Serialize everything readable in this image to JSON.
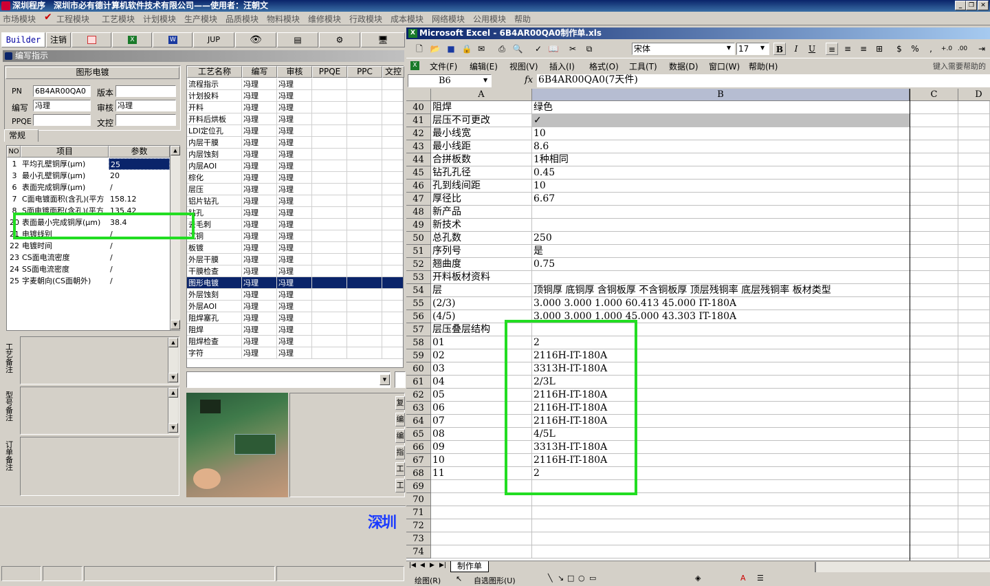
{
  "app_title": "深圳程序　深圳市必有德计算机软件技术有限公司——使用者：汪朝文",
  "menu": [
    "市场模块",
    "工程模块",
    "工艺模块",
    "计划模块",
    "生产模块",
    "品质模块",
    "物料模块",
    "维修模块",
    "行政模块",
    "成本模块",
    "网络模块",
    "公用模块",
    "帮助"
  ],
  "toolbar": {
    "builder": "Builder",
    "logout": "注销",
    "jup": "JUP"
  },
  "panel_title": "编写指示",
  "form": {
    "section_title": "图形电镀",
    "pn_label": "PN",
    "pn_value": "6B4AR00QA0",
    "version_label": "版本",
    "version_value": "",
    "writer_label": "编写",
    "writer_value": "冯理",
    "reviewer_label": "审核",
    "reviewer_value": "冯理",
    "ppqe_label": "PPQE",
    "ppqe_value": "",
    "control_label": "文控",
    "control_value": ""
  },
  "tab_general": "常规",
  "param_table": {
    "headers": [
      "NO",
      "项目",
      "参数"
    ],
    "rows": [
      {
        "no": "1",
        "item": "平均孔壁铜厚(μm)",
        "value": "25"
      },
      {
        "no": "3",
        "item": "最小孔壁铜厚(μm)",
        "value": "20"
      },
      {
        "no": "6",
        "item": "表面完成铜厚(μm)",
        "value": "/"
      },
      {
        "no": "7",
        "item": "C面电镀面积(含孔)(平方",
        "value": "158.12"
      },
      {
        "no": "8",
        "item": "S面电镀面积(含孔)(平方",
        "value": "135.42"
      },
      {
        "no": "20",
        "item": "表面最小完成铜厚(μm)",
        "value": "38.4"
      },
      {
        "no": "21",
        "item": "电镀线别",
        "value": "/"
      },
      {
        "no": "22",
        "item": "电镀时间",
        "value": "/"
      },
      {
        "no": "23",
        "item": "CS面电流密度",
        "value": "/"
      },
      {
        "no": "24",
        "item": "SS面电流密度",
        "value": "/"
      },
      {
        "no": "25",
        "item": "字麦朝向(CS面朝外)",
        "value": "/"
      }
    ]
  },
  "notes": {
    "process": "工艺备注",
    "model": "型号备注",
    "order": "订单备注"
  },
  "process_table": {
    "headers": [
      "工艺名称",
      "编写",
      "审核",
      "PPQE",
      "PPC",
      "文控"
    ],
    "rows": [
      {
        "name": "流程指示",
        "w": "冯理",
        "r": "冯理"
      },
      {
        "name": "计划投料",
        "w": "冯理",
        "r": "冯理"
      },
      {
        "name": "开料",
        "w": "冯理",
        "r": "冯理"
      },
      {
        "name": "开料后烘板",
        "w": "冯理",
        "r": "冯理"
      },
      {
        "name": "LDI定位孔",
        "w": "冯理",
        "r": "冯理"
      },
      {
        "name": "内层干膜",
        "w": "冯理",
        "r": "冯理"
      },
      {
        "name": "内层蚀刻",
        "w": "冯理",
        "r": "冯理"
      },
      {
        "name": "内层AOI",
        "w": "冯理",
        "r": "冯理"
      },
      {
        "name": "棕化",
        "w": "冯理",
        "r": "冯理"
      },
      {
        "name": "层压",
        "w": "冯理",
        "r": "冯理"
      },
      {
        "name": "铝片钻孔",
        "w": "冯理",
        "r": "冯理"
      },
      {
        "name": "钻孔",
        "w": "冯理",
        "r": "冯理"
      },
      {
        "name": "去毛刺",
        "w": "冯理",
        "r": "冯理"
      },
      {
        "name": "沉铜",
        "w": "冯理",
        "r": "冯理"
      },
      {
        "name": "板镀",
        "w": "冯理",
        "r": "冯理"
      },
      {
        "name": "外层干膜",
        "w": "冯理",
        "r": "冯理"
      },
      {
        "name": "干膜检查",
        "w": "冯理",
        "r": "冯理"
      },
      {
        "name": "图形电镀",
        "w": "冯理",
        "r": "冯理"
      },
      {
        "name": "外层蚀刻",
        "w": "冯理",
        "r": "冯理"
      },
      {
        "name": "外层AOI",
        "w": "冯理",
        "r": "冯理"
      },
      {
        "name": "阻焊塞孔",
        "w": "冯理",
        "r": "冯理"
      },
      {
        "name": "阻焊",
        "w": "冯理",
        "r": "冯理"
      },
      {
        "name": "阻焊检查",
        "w": "冯理",
        "r": "冯理"
      },
      {
        "name": "字符",
        "w": "冯理",
        "r": "冯理"
      }
    ]
  },
  "side_buttons": [
    "复",
    "编",
    "编",
    "指",
    "工",
    "工"
  ],
  "excel": {
    "title": "Microsoft Excel - 6B4AR00QA0制作单.xls",
    "menu": [
      "文件(F)",
      "编辑(E)",
      "视图(V)",
      "插入(I)",
      "格式(O)",
      "工具(T)",
      "数据(D)",
      "窗口(W)",
      "帮助(H)"
    ],
    "help_placeholder": "键入需要帮助的",
    "font_name": "宋体",
    "font_size": "17",
    "name_box": "B6",
    "formula": "6B4AR00QA0(7天件)",
    "columns": [
      "A",
      "B",
      "C",
      "D"
    ],
    "sheet_tab": "制作单",
    "rows": [
      {
        "n": "40",
        "a": "阻焊",
        "b": "绿色"
      },
      {
        "n": "41",
        "a": "层压不可更改",
        "b": "✓"
      },
      {
        "n": "42",
        "a": "最小线宽",
        "b": "10"
      },
      {
        "n": "43",
        "a": "最小线距",
        "b": "8.6"
      },
      {
        "n": "44",
        "a": "合拼板数",
        "b": "1种相同"
      },
      {
        "n": "45",
        "a": "钻孔孔径",
        "b": "0.45"
      },
      {
        "n": "46",
        "a": "孔到线间距",
        "b": "10"
      },
      {
        "n": "47",
        "a": "厚径比",
        "b": "6.67"
      },
      {
        "n": "48",
        "a": "新产品",
        "b": ""
      },
      {
        "n": "49",
        "a": "新技术",
        "b": ""
      },
      {
        "n": "50",
        "a": "总孔数",
        "b": "250"
      },
      {
        "n": "51",
        "a": "序列号",
        "b": "是"
      },
      {
        "n": "52",
        "a": "翘曲度",
        "b": "0.75"
      },
      {
        "n": "53",
        "a": "开料板材资料",
        "b": ""
      },
      {
        "n": "54",
        "a": "层",
        "b": "顶铜厚 底铜厚 含铜板厚 不含铜板厚 顶层残铜率 底层残铜率 板材类型"
      },
      {
        "n": "55",
        "a": "(2/3)",
        "b": "3.000  3.000  1.000           60.413  45.000   IT-180A"
      },
      {
        "n": "56",
        "a": "(4/5)",
        "b": "3.000  3.000  1.000           45.000  43.303   IT-180A"
      },
      {
        "n": "57",
        "a": "层压叠层结构",
        "b": ""
      },
      {
        "n": "58",
        "a": "01",
        "b": "2"
      },
      {
        "n": "59",
        "a": "02",
        "b": "2116H-IT-180A"
      },
      {
        "n": "60",
        "a": "03",
        "b": "3313H-IT-180A"
      },
      {
        "n": "61",
        "a": "04",
        "b": "2/3L"
      },
      {
        "n": "62",
        "a": "05",
        "b": "2116H-IT-180A"
      },
      {
        "n": "63",
        "a": "06",
        "b": "2116H-IT-180A"
      },
      {
        "n": "64",
        "a": "07",
        "b": "2116H-IT-180A"
      },
      {
        "n": "65",
        "a": "08",
        "b": "4/5L"
      },
      {
        "n": "66",
        "a": "09",
        "b": "3313H-IT-180A"
      },
      {
        "n": "67",
        "a": "10",
        "b": "2116H-IT-180A"
      },
      {
        "n": "68",
        "a": "11",
        "b": "2"
      },
      {
        "n": "69",
        "a": "",
        "b": ""
      },
      {
        "n": "70",
        "a": "",
        "b": ""
      },
      {
        "n": "71",
        "a": "",
        "b": ""
      },
      {
        "n": "72",
        "a": "",
        "b": ""
      },
      {
        "n": "73",
        "a": "",
        "b": ""
      },
      {
        "n": "74",
        "a": "",
        "b": ""
      }
    ]
  },
  "drawing_toolbar": {
    "draw": "绘图(R)",
    "autoshape": "自选图形(U)"
  },
  "colors": {
    "highlight": "#22dd22",
    "selection": "#0a246a",
    "title": "#0a246a"
  }
}
